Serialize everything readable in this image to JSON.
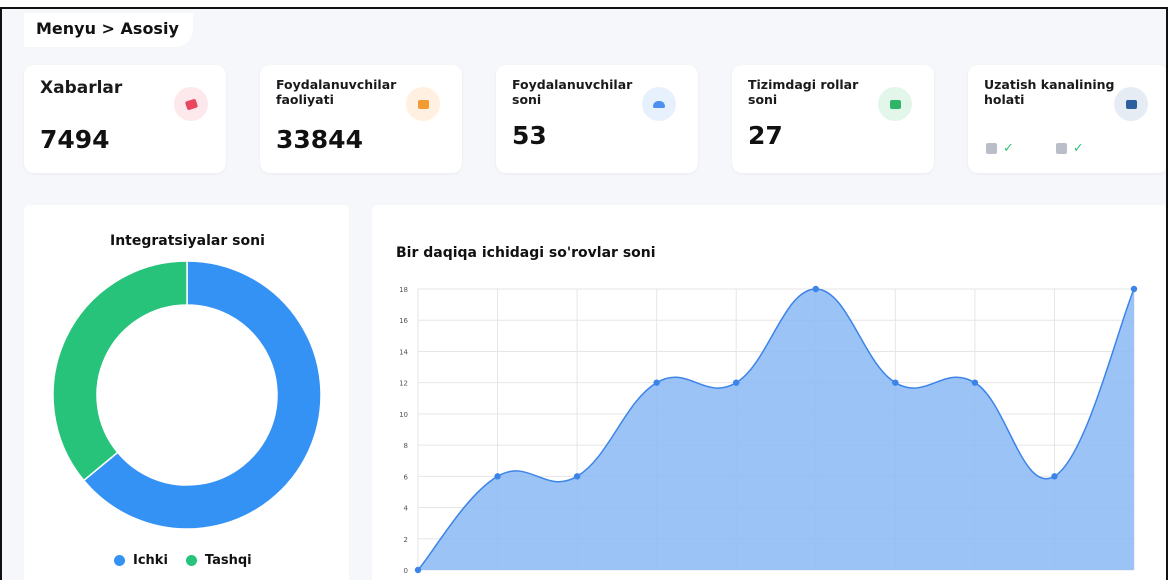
{
  "breadcrumb": "Menyu > Asosiy",
  "cards": [
    {
      "title": "Xabarlar",
      "value": "7494",
      "icon": "chat-icon",
      "icon_color": "#e8475f",
      "icon_bg": "#fde8ec"
    },
    {
      "title": "Foydalanuvchilar faoliyati",
      "value": "33844",
      "icon": "activity-icon",
      "icon_color": "#f39a33",
      "icon_bg": "#fff0e2"
    },
    {
      "title": "Foydalanuvchilar soni",
      "value": "53",
      "icon": "users-icon",
      "icon_color": "#4e8ff0",
      "icon_bg": "#e7f0fd"
    },
    {
      "title": "Tizimdagi rollar soni",
      "value": "27",
      "icon": "roles-icon",
      "icon_color": "#2fb56a",
      "icon_bg": "#e3f6ea"
    },
    {
      "title": "Uzatish kanalining holati",
      "icon": "network-icon",
      "icon_color": "#2d5f9e",
      "icon_bg": "#e6ecf3",
      "status": [
        {
          "icon": "server-icon",
          "state": "check-icon"
        },
        {
          "icon": "server-icon",
          "state": "check-icon"
        }
      ]
    }
  ],
  "donut_title": "Integratsiyalar soni",
  "line_title": "Bir daqiqa ichidagi so'rovlar soni",
  "colors": {
    "ichki": "#3592f5",
    "tashqi": "#27c37b",
    "area_fill": "#8ab8f5",
    "area_line": "#3d84e8"
  },
  "chart_data": [
    {
      "type": "pie",
      "title": "Integratsiyalar soni",
      "variant": "donut",
      "categories": [
        "Ichki",
        "Tashqi"
      ],
      "values": [
        64,
        36
      ],
      "legend": "bottom"
    },
    {
      "type": "area",
      "title": "Bir daqiqa ichidagi so'rovlar soni",
      "x": [
        0,
        1,
        2,
        3,
        4,
        5,
        6,
        7,
        8,
        9
      ],
      "y": [
        0,
        6,
        6,
        12,
        12,
        18,
        12,
        12,
        6,
        18
      ],
      "ylim": [
        0,
        18
      ],
      "yticks": [
        "0",
        "2",
        "4",
        "6",
        "8",
        "10",
        "12",
        "14",
        "16",
        "18"
      ],
      "grid": true
    }
  ]
}
